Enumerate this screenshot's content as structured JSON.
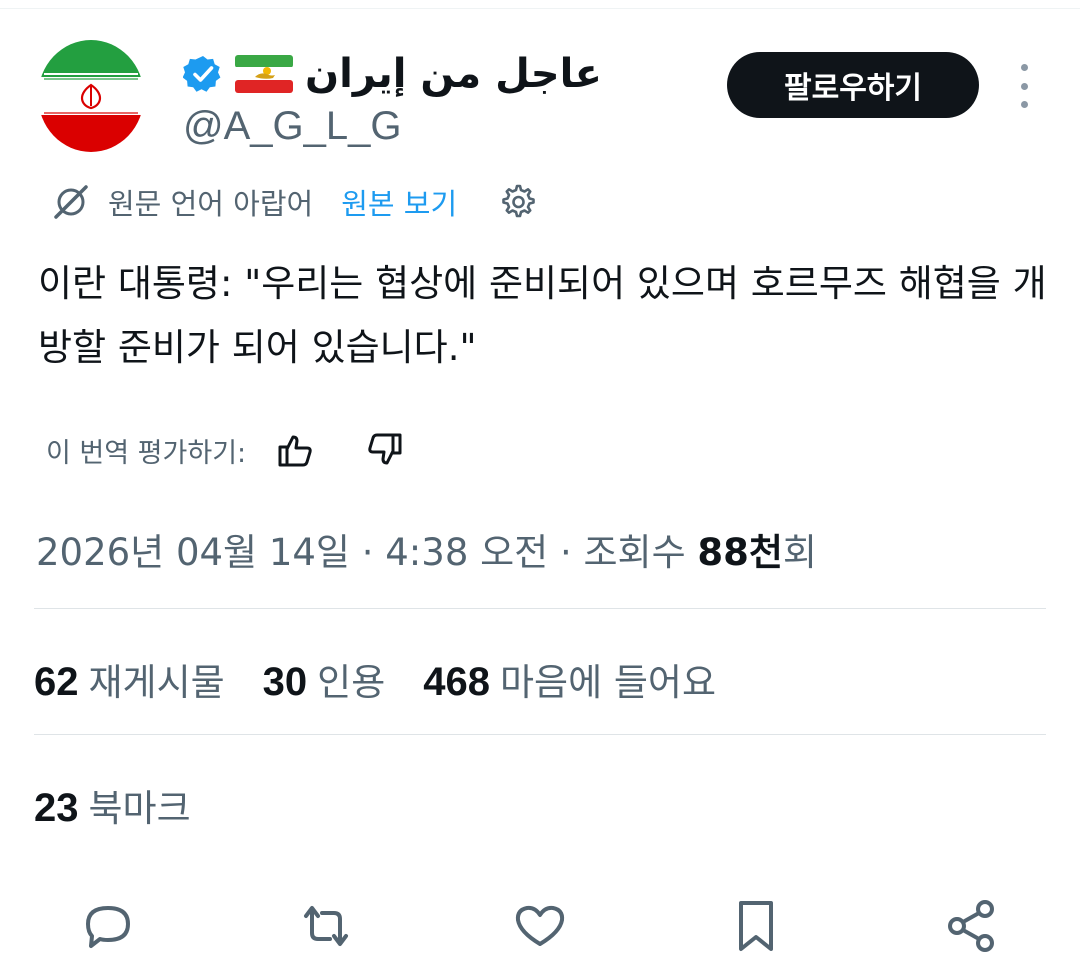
{
  "author": {
    "display_name": "عاجل من إيران",
    "handle": "@A_G_L_G",
    "verified": true,
    "flag_emoji": "Iran (Lion and Sun) flag"
  },
  "follow_button": {
    "label": "팔로우하기"
  },
  "translation": {
    "notice": "원문 언어 아랍어",
    "show_original": "원본 보기"
  },
  "tweet": {
    "text": "이란 대통령: \"우리는 협상에 준비되어 있으며 호르무즈 해협을 개방할 준비가 되어 있습니다.\""
  },
  "rate_translation": {
    "label": "이 번역 평가하기:"
  },
  "meta": {
    "date": "2026년 04월 14일",
    "separator": "·",
    "time": "4:38 오전",
    "views_label": "조회수",
    "views_count": "88천",
    "views_suffix": "회"
  },
  "stats": [
    {
      "count": "62",
      "label": "재게시물"
    },
    {
      "count": "30",
      "label": "인용"
    },
    {
      "count": "468",
      "label": "마음에 들어요"
    }
  ],
  "bookmarks": {
    "count": "23",
    "label": "북마크"
  },
  "actions": [
    "reply-icon",
    "repost-icon",
    "like-icon",
    "bookmark-icon",
    "share-icon"
  ],
  "colors": {
    "text": "#0f1419",
    "secondary": "#536471",
    "link": "#1d9bf0",
    "button_bg": "#0f1419",
    "divider": "#dfe4e7"
  }
}
